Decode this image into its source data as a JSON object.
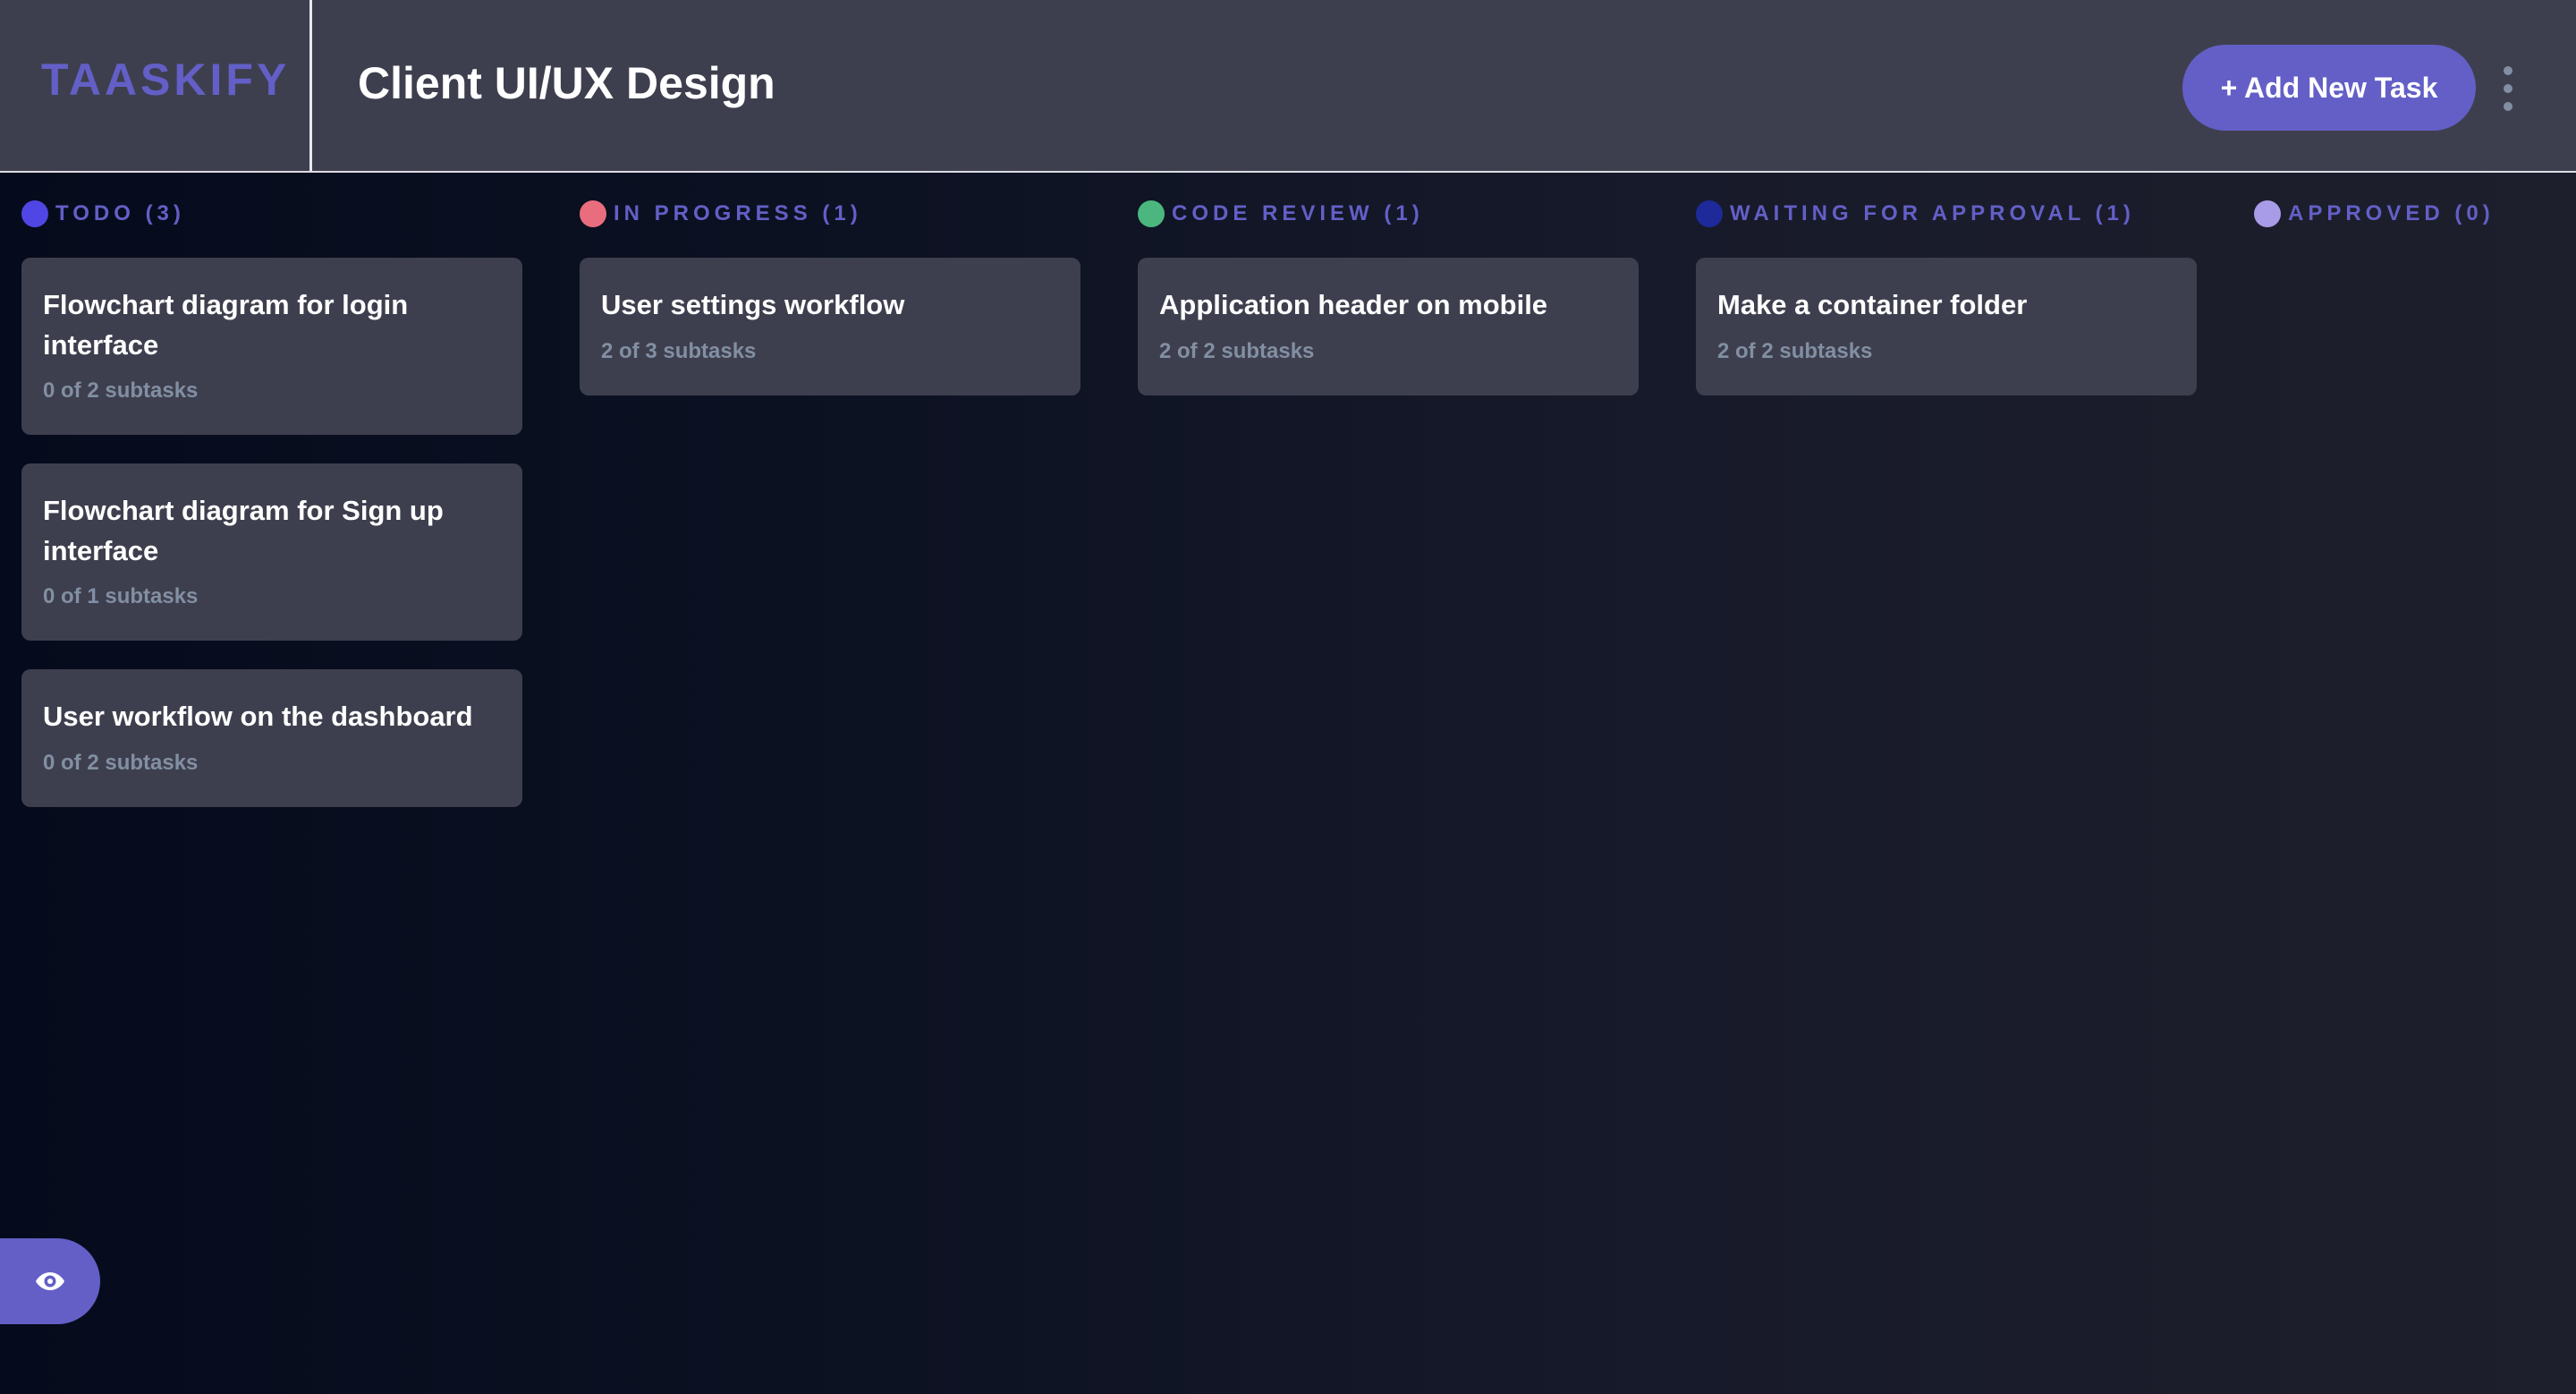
{
  "app": {
    "logo": "TAASKIFY",
    "board_title": "Client UI/UX Design",
    "add_task_label": "+ Add New Task"
  },
  "colors": {
    "accent": "#635fc7",
    "header_bg": "#3e3f4e",
    "card_bg": "#3e3f4e",
    "subtext": "#828fa3"
  },
  "columns": [
    {
      "title": "TODO (3)",
      "dot_color": "#4f46e5",
      "cards": [
        {
          "title": "Flowchart diagram for login interface",
          "subtasks": "0 of 2 subtasks"
        },
        {
          "title": "Flowchart diagram for Sign up interface",
          "subtasks": "0 of 1 subtasks"
        },
        {
          "title": "User workflow on the dashboard",
          "subtasks": "0 of 2 subtasks"
        }
      ]
    },
    {
      "title": "IN PROGRESS (1)",
      "dot_color": "#ea6d7e",
      "cards": [
        {
          "title": "User settings workflow",
          "subtasks": "2 of 3 subtasks"
        }
      ]
    },
    {
      "title": "CODE REVIEW (1)",
      "dot_color": "#4cb67f",
      "cards": [
        {
          "title": "Application header on mobile",
          "subtasks": "2 of 2 subtasks"
        }
      ]
    },
    {
      "title": "WAITING FOR APPROVAL (1)",
      "dot_color": "#1e2a9a",
      "cards": [
        {
          "title": "Make a container folder",
          "subtasks": "2 of 2 subtasks"
        }
      ]
    },
    {
      "title": "APPROVED (0)",
      "dot_color": "#a89ce8",
      "cards": []
    }
  ],
  "icons": {
    "menu": "vertical-ellipsis-icon",
    "show_sidebar": "eye-icon"
  }
}
